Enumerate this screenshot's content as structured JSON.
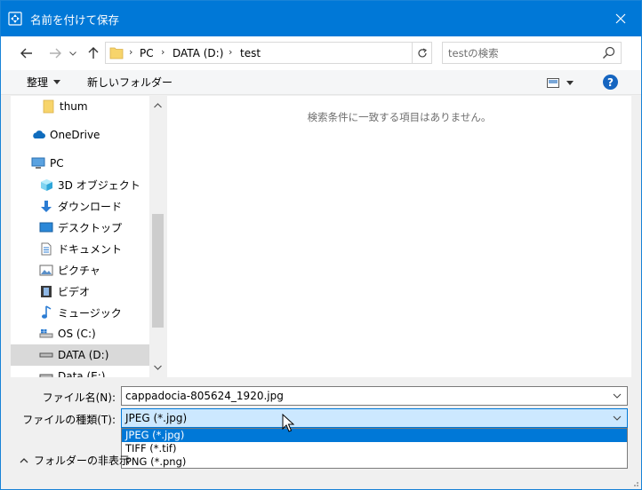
{
  "window": {
    "title": "名前を付けて保存",
    "accent": "#0078d7"
  },
  "address_bar": {
    "breadcrumbs": [
      "PC",
      "DATA (D:)",
      "test"
    ],
    "search_placeholder": "testの検索"
  },
  "toolbar": {
    "organize_label": "整理",
    "new_folder_label": "新しいフォルダー"
  },
  "nav": {
    "items": [
      {
        "label": "thum",
        "icon": "folder-icon"
      },
      {
        "label": "OneDrive",
        "icon": "cloud-icon"
      },
      {
        "label": "PC",
        "icon": "computer-icon"
      },
      {
        "label": "3D オブジェクト",
        "icon": "cube-icon"
      },
      {
        "label": "ダウンロード",
        "icon": "download-icon"
      },
      {
        "label": "デスクトップ",
        "icon": "desktop-icon"
      },
      {
        "label": "ドキュメント",
        "icon": "document-icon"
      },
      {
        "label": "ピクチャ",
        "icon": "picture-icon"
      },
      {
        "label": "ビデオ",
        "icon": "video-icon"
      },
      {
        "label": "ミュージック",
        "icon": "music-icon"
      },
      {
        "label": "OS (C:)",
        "icon": "drive-icon"
      },
      {
        "label": "DATA (D:)",
        "icon": "drive-icon"
      },
      {
        "label": "Data (E:)",
        "icon": "drive-icon"
      }
    ]
  },
  "content": {
    "empty_message": "検索条件に一致する項目はありません。"
  },
  "form": {
    "filename_label": "ファイル名(N):",
    "filename_value": "cappadocia-805624_1920.jpg",
    "filetype_label": "ファイルの種類(T):",
    "filetype_value": "JPEG (*.jpg)",
    "filetype_options": [
      "JPEG (*.jpg)",
      "TIFF (*.tif)",
      "PNG (*.png)"
    ],
    "hide_folders_label": "フォルダーの非表示"
  }
}
